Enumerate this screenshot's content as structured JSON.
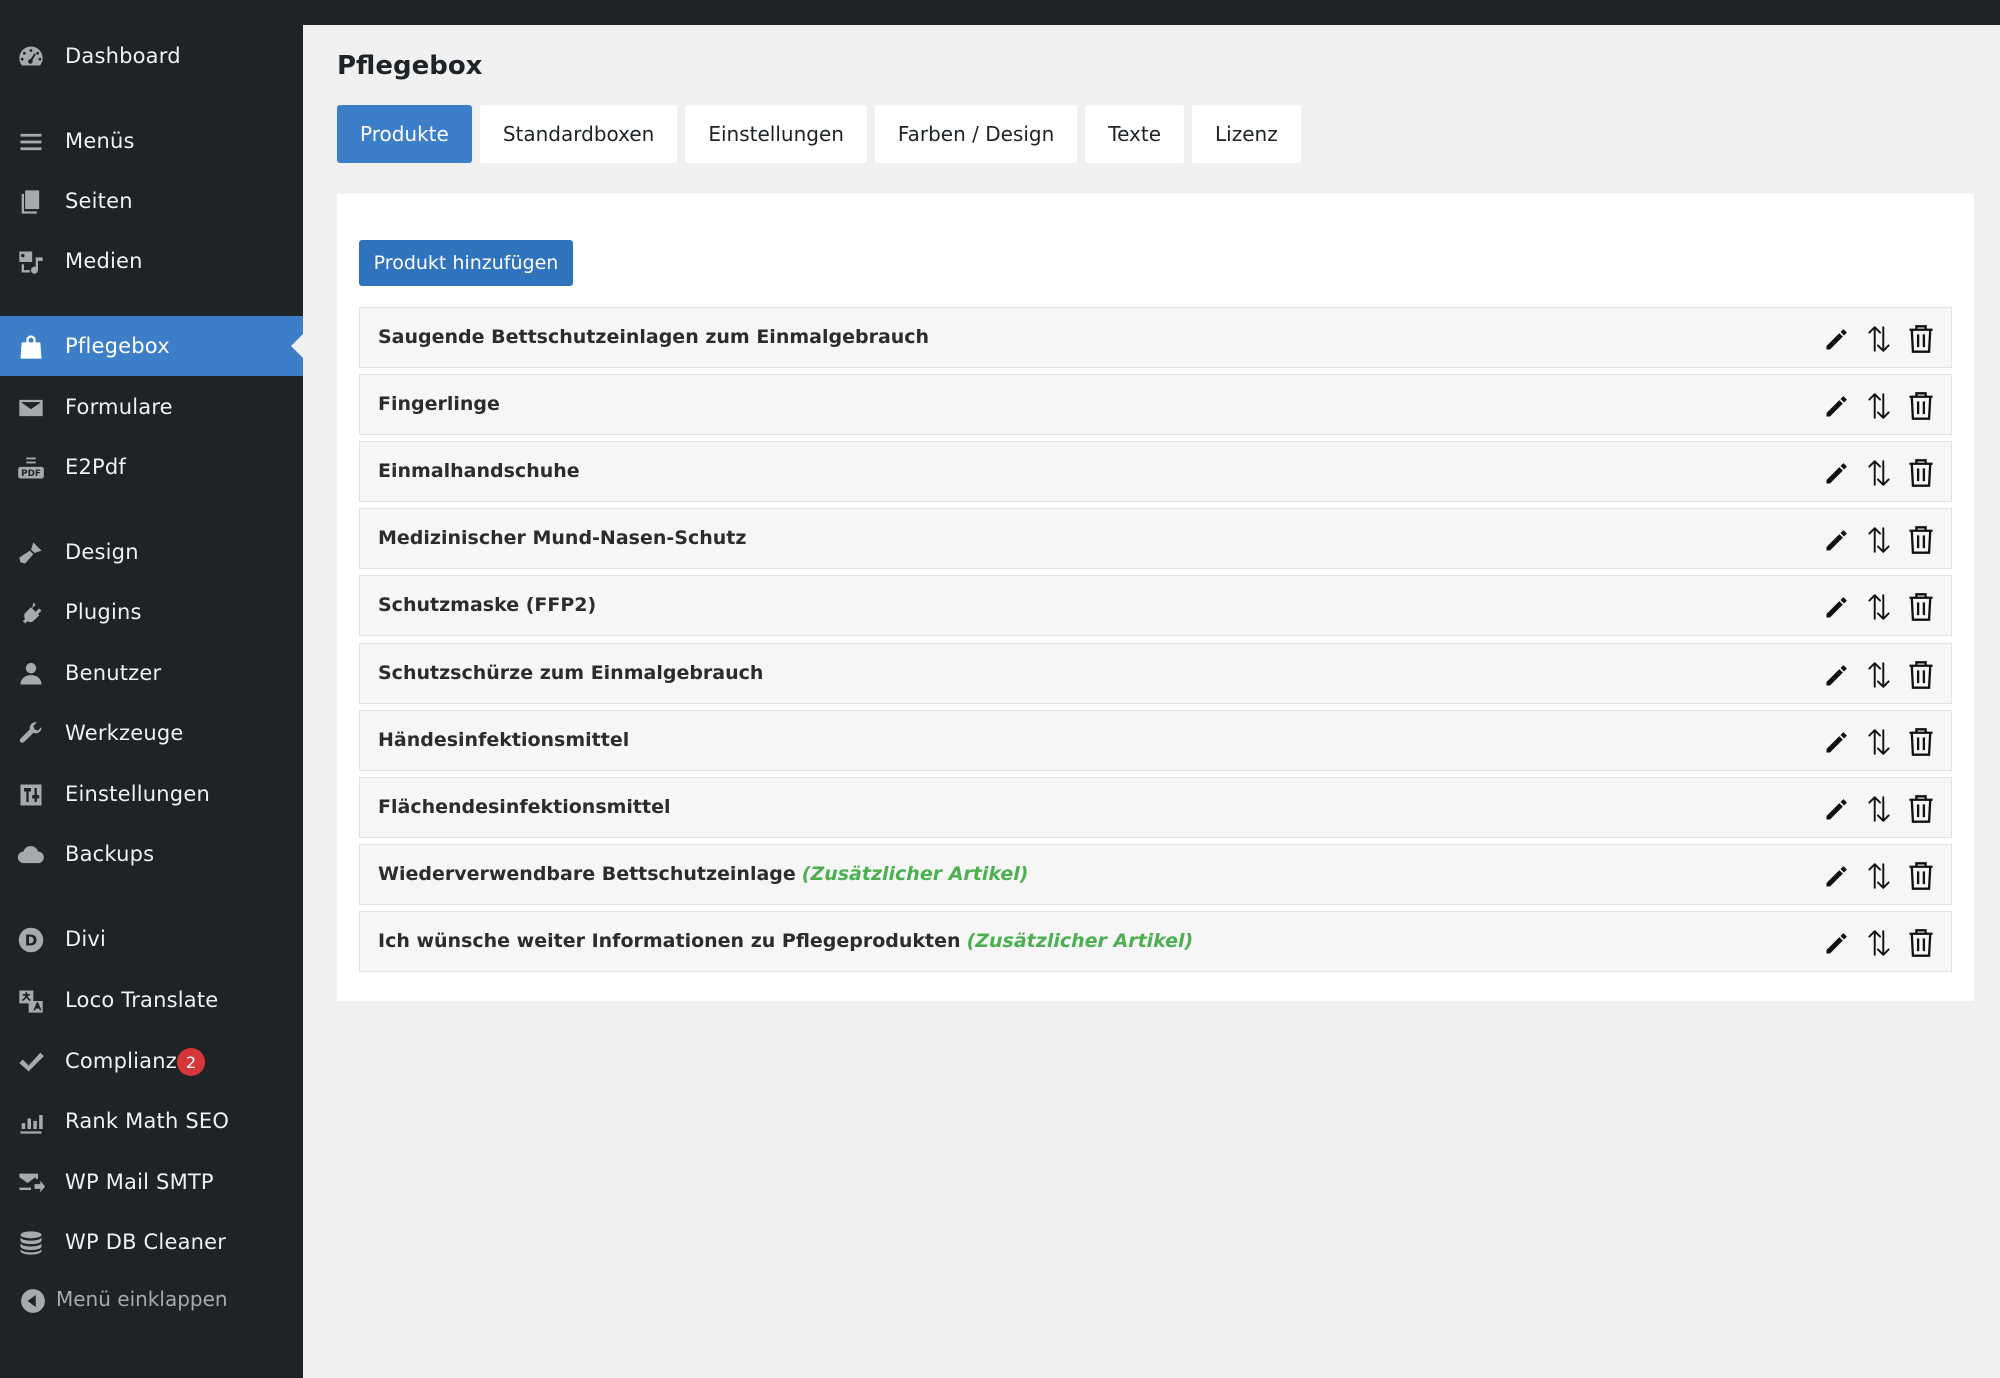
{
  "sidebar": {
    "items": [
      {
        "label": "Dashboard",
        "icon": "dashboard-icon"
      },
      {
        "label": "Menüs",
        "icon": "menu-lines-icon"
      },
      {
        "label": "Seiten",
        "icon": "pages-icon"
      },
      {
        "label": "Medien",
        "icon": "media-icon"
      },
      {
        "label": "Pflegebox",
        "icon": "shopping-bag-icon",
        "active": true
      },
      {
        "label": "Formulare",
        "icon": "envelope-icon"
      },
      {
        "label": "E2Pdf",
        "icon": "pdf-icon"
      },
      {
        "label": "Design",
        "icon": "brush-icon"
      },
      {
        "label": "Plugins",
        "icon": "plug-icon"
      },
      {
        "label": "Benutzer",
        "icon": "user-icon"
      },
      {
        "label": "Werkzeuge",
        "icon": "wrench-icon"
      },
      {
        "label": "Einstellungen",
        "icon": "settings-sliders-icon"
      },
      {
        "label": "Backups",
        "icon": "cloud-icon"
      },
      {
        "label": "Divi",
        "icon": "divi-icon"
      },
      {
        "label": "Loco Translate",
        "icon": "translate-icon"
      },
      {
        "label": "Complianz",
        "icon": "checkmark-icon",
        "badge": "2"
      },
      {
        "label": "Rank Math SEO",
        "icon": "chart-icon"
      },
      {
        "label": "WP Mail SMTP",
        "icon": "mail-send-icon"
      },
      {
        "label": "WP DB Cleaner",
        "icon": "database-icon"
      }
    ],
    "collapse_label": "Menü einklappen"
  },
  "page": {
    "title": "Pflegebox",
    "tabs": [
      "Produkte",
      "Standardboxen",
      "Einstellungen",
      "Farben / Design",
      "Texte",
      "Lizenz"
    ],
    "active_tab": "Produkte",
    "add_button": "Produkt hinzufügen",
    "products": [
      {
        "name": "Saugende Bettschutzeinlagen zum Einmalgebrauch",
        "extra": ""
      },
      {
        "name": "Fingerlinge",
        "extra": ""
      },
      {
        "name": "Einmalhandschuhe",
        "extra": ""
      },
      {
        "name": "Medizinischer Mund-Nasen-Schutz",
        "extra": ""
      },
      {
        "name": "Schutzmaske (FFP2)",
        "extra": ""
      },
      {
        "name": "Schutzschürze zum Einmalgebrauch",
        "extra": ""
      },
      {
        "name": "Händesinfektionsmittel",
        "extra": ""
      },
      {
        "name": "Flächendesinfektionsmittel",
        "extra": ""
      },
      {
        "name": "Wiederverwendbare Bettschutzeinlage",
        "extra": "(Zusätzlicher Artikel)"
      },
      {
        "name": "Ich wünsche weiter Informationen zu Pflegeprodukten",
        "extra": "(Zusätzlicher Artikel)"
      }
    ]
  },
  "colors": {
    "sidebar_bg": "#1d2327",
    "accent": "#3d7ec9",
    "extra_text": "#4caf50",
    "badge": "#d63638"
  }
}
